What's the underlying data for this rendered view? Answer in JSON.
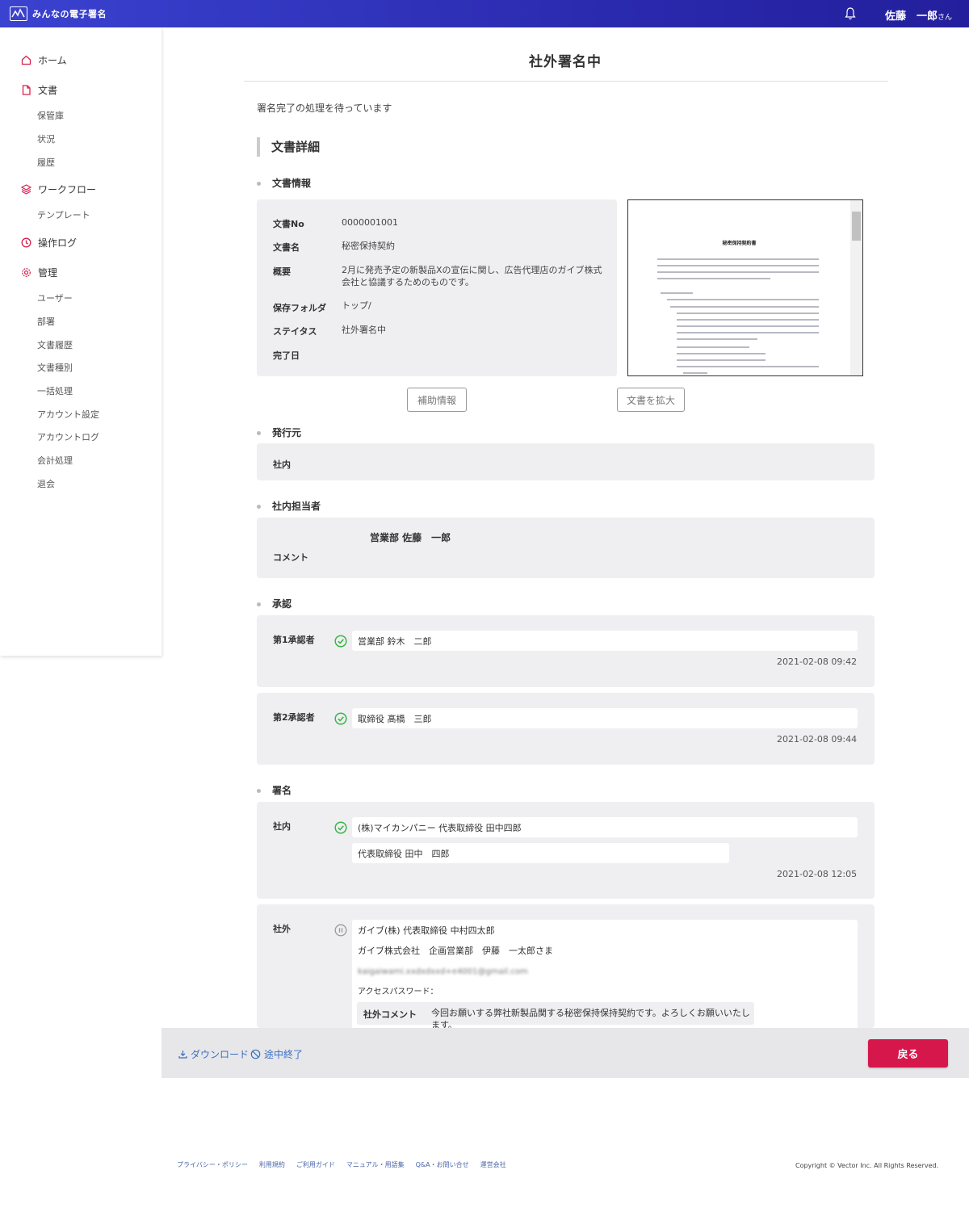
{
  "header": {
    "logo_text": "みんなの電子署名",
    "user_name": "佐藤　一郎",
    "user_suffix": "さん"
  },
  "sidebar": {
    "home": "ホーム",
    "documents": "文書",
    "doc_items": [
      "保管庫",
      "状況",
      "履歴"
    ],
    "workflow": "ワークフロー",
    "workflow_items": [
      "テンプレート"
    ],
    "oplog": "操作ログ",
    "admin": "管理",
    "admin_items": [
      "ユーザー",
      "部署",
      "文書履歴",
      "文書種別",
      "一括処理",
      "アカウント設定",
      "アカウントログ",
      "会計処理",
      "退会"
    ]
  },
  "page": {
    "title": "社外署名中",
    "status_message": "署名完了の処理を待っています",
    "section_title": "文書詳細"
  },
  "doc_info": {
    "heading": "文書情報",
    "rows": [
      {
        "label": "文書No",
        "value": "0000001001"
      },
      {
        "label": "文書名",
        "value": "秘密保持契約"
      },
      {
        "label": "概要",
        "value": "2月に発売予定の新製品Xの宣伝に関し、広告代理店のガイブ株式会社と協議するためのものです。"
      },
      {
        "label": "保存フォルダ",
        "value": "トップ/"
      },
      {
        "label": "ステイタス",
        "value": "社外署名中"
      },
      {
        "label": "完了日",
        "value": ""
      }
    ],
    "btn_aux": "補助情報",
    "btn_zoom": "文書を拡大",
    "preview_title": "秘密保持契約書"
  },
  "issuer": {
    "heading": "発行元",
    "value": "社内"
  },
  "internal_owner": {
    "heading": "社内担当者",
    "name": "営業部 佐藤　一郎",
    "comment_label": "コメント"
  },
  "approval": {
    "heading": "承認",
    "approvers": [
      {
        "label": "第1承認者",
        "name": "営業部 鈴木　二郎",
        "timestamp": "2021-02-08 09:42"
      },
      {
        "label": "第2承認者",
        "name": "取締役 髙橋　三郎",
        "timestamp": "2021-02-08 09:44"
      }
    ]
  },
  "signature": {
    "heading": "署名",
    "internal": {
      "label": "社内",
      "company": "(株)マイカンパニー 代表取締役 田中四郎",
      "signer": "代表取締役 田中　四郎",
      "timestamp": "2021-02-08 12:05"
    },
    "external": {
      "label": "社外",
      "company": "ガイブ(株) 代表取締役 中村四太郎",
      "contact": "ガイブ株式会社　企画営業部　伊藤　一太郎さま",
      "email": "kaigaiwami.xxdxdxxd+e4001@gmail.com",
      "password_label": "アクセスパスワード：",
      "comment_label": "社外コメント",
      "comment": "今回お願いする弊社新製品関する秘密保持保持契約です。よろしくお願いいたします。"
    }
  },
  "actions": {
    "download": "ダウンロード",
    "abort": "途中終了",
    "back": "戻る"
  },
  "footer": {
    "links": [
      "プライバシー・ポリシー",
      "利用規約",
      "ご利用ガイド",
      "マニュアル・用語集",
      "Q&A・お問い合せ",
      "運営会社"
    ],
    "copyright": "Copyright © Vector Inc. All Rights Reserved."
  },
  "colors": {
    "header_start": "#3a42d0",
    "header_end": "#231f9c",
    "accent": "#d6174c",
    "check_green": "#3cb54a",
    "link_blue": "#3a6fc0"
  }
}
